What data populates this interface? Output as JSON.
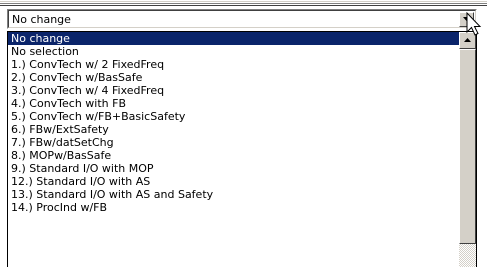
{
  "combo": {
    "value": "No change",
    "button_icon": "chevron-down-icon"
  },
  "dropdown": {
    "selected_index": 0,
    "items": [
      {
        "label": "No change"
      },
      {
        "label": "No selection"
      },
      {
        "label": "1.) ConvTech w/ 2 FixedFreq"
      },
      {
        "label": "2.) ConvTech w/BasSafe"
      },
      {
        "label": "3.) ConvTech w/ 4 FixedFreq"
      },
      {
        "label": "4.) ConvTech with FB"
      },
      {
        "label": "5.) ConvTech w/FB+BasicSafety"
      },
      {
        "label": "6.) FBw/ExtSafety"
      },
      {
        "label": "7.) FBw/datSetChg"
      },
      {
        "label": "8.) MOPw/BasSafe"
      },
      {
        "label": "9.) Standard I/O with MOP"
      },
      {
        "label": "12.) Standard I/O with AS"
      },
      {
        "label": "13.) Standard I/O with AS and Safety"
      },
      {
        "label": "14.) ProcInd w/FB"
      }
    ]
  },
  "scrollbar": {
    "up_icon": "chevron-up-icon",
    "position": 0.0
  },
  "colors": {
    "selection_bg": "#0a246a",
    "selection_fg": "#ffffff",
    "face": "#d4d0c8"
  }
}
